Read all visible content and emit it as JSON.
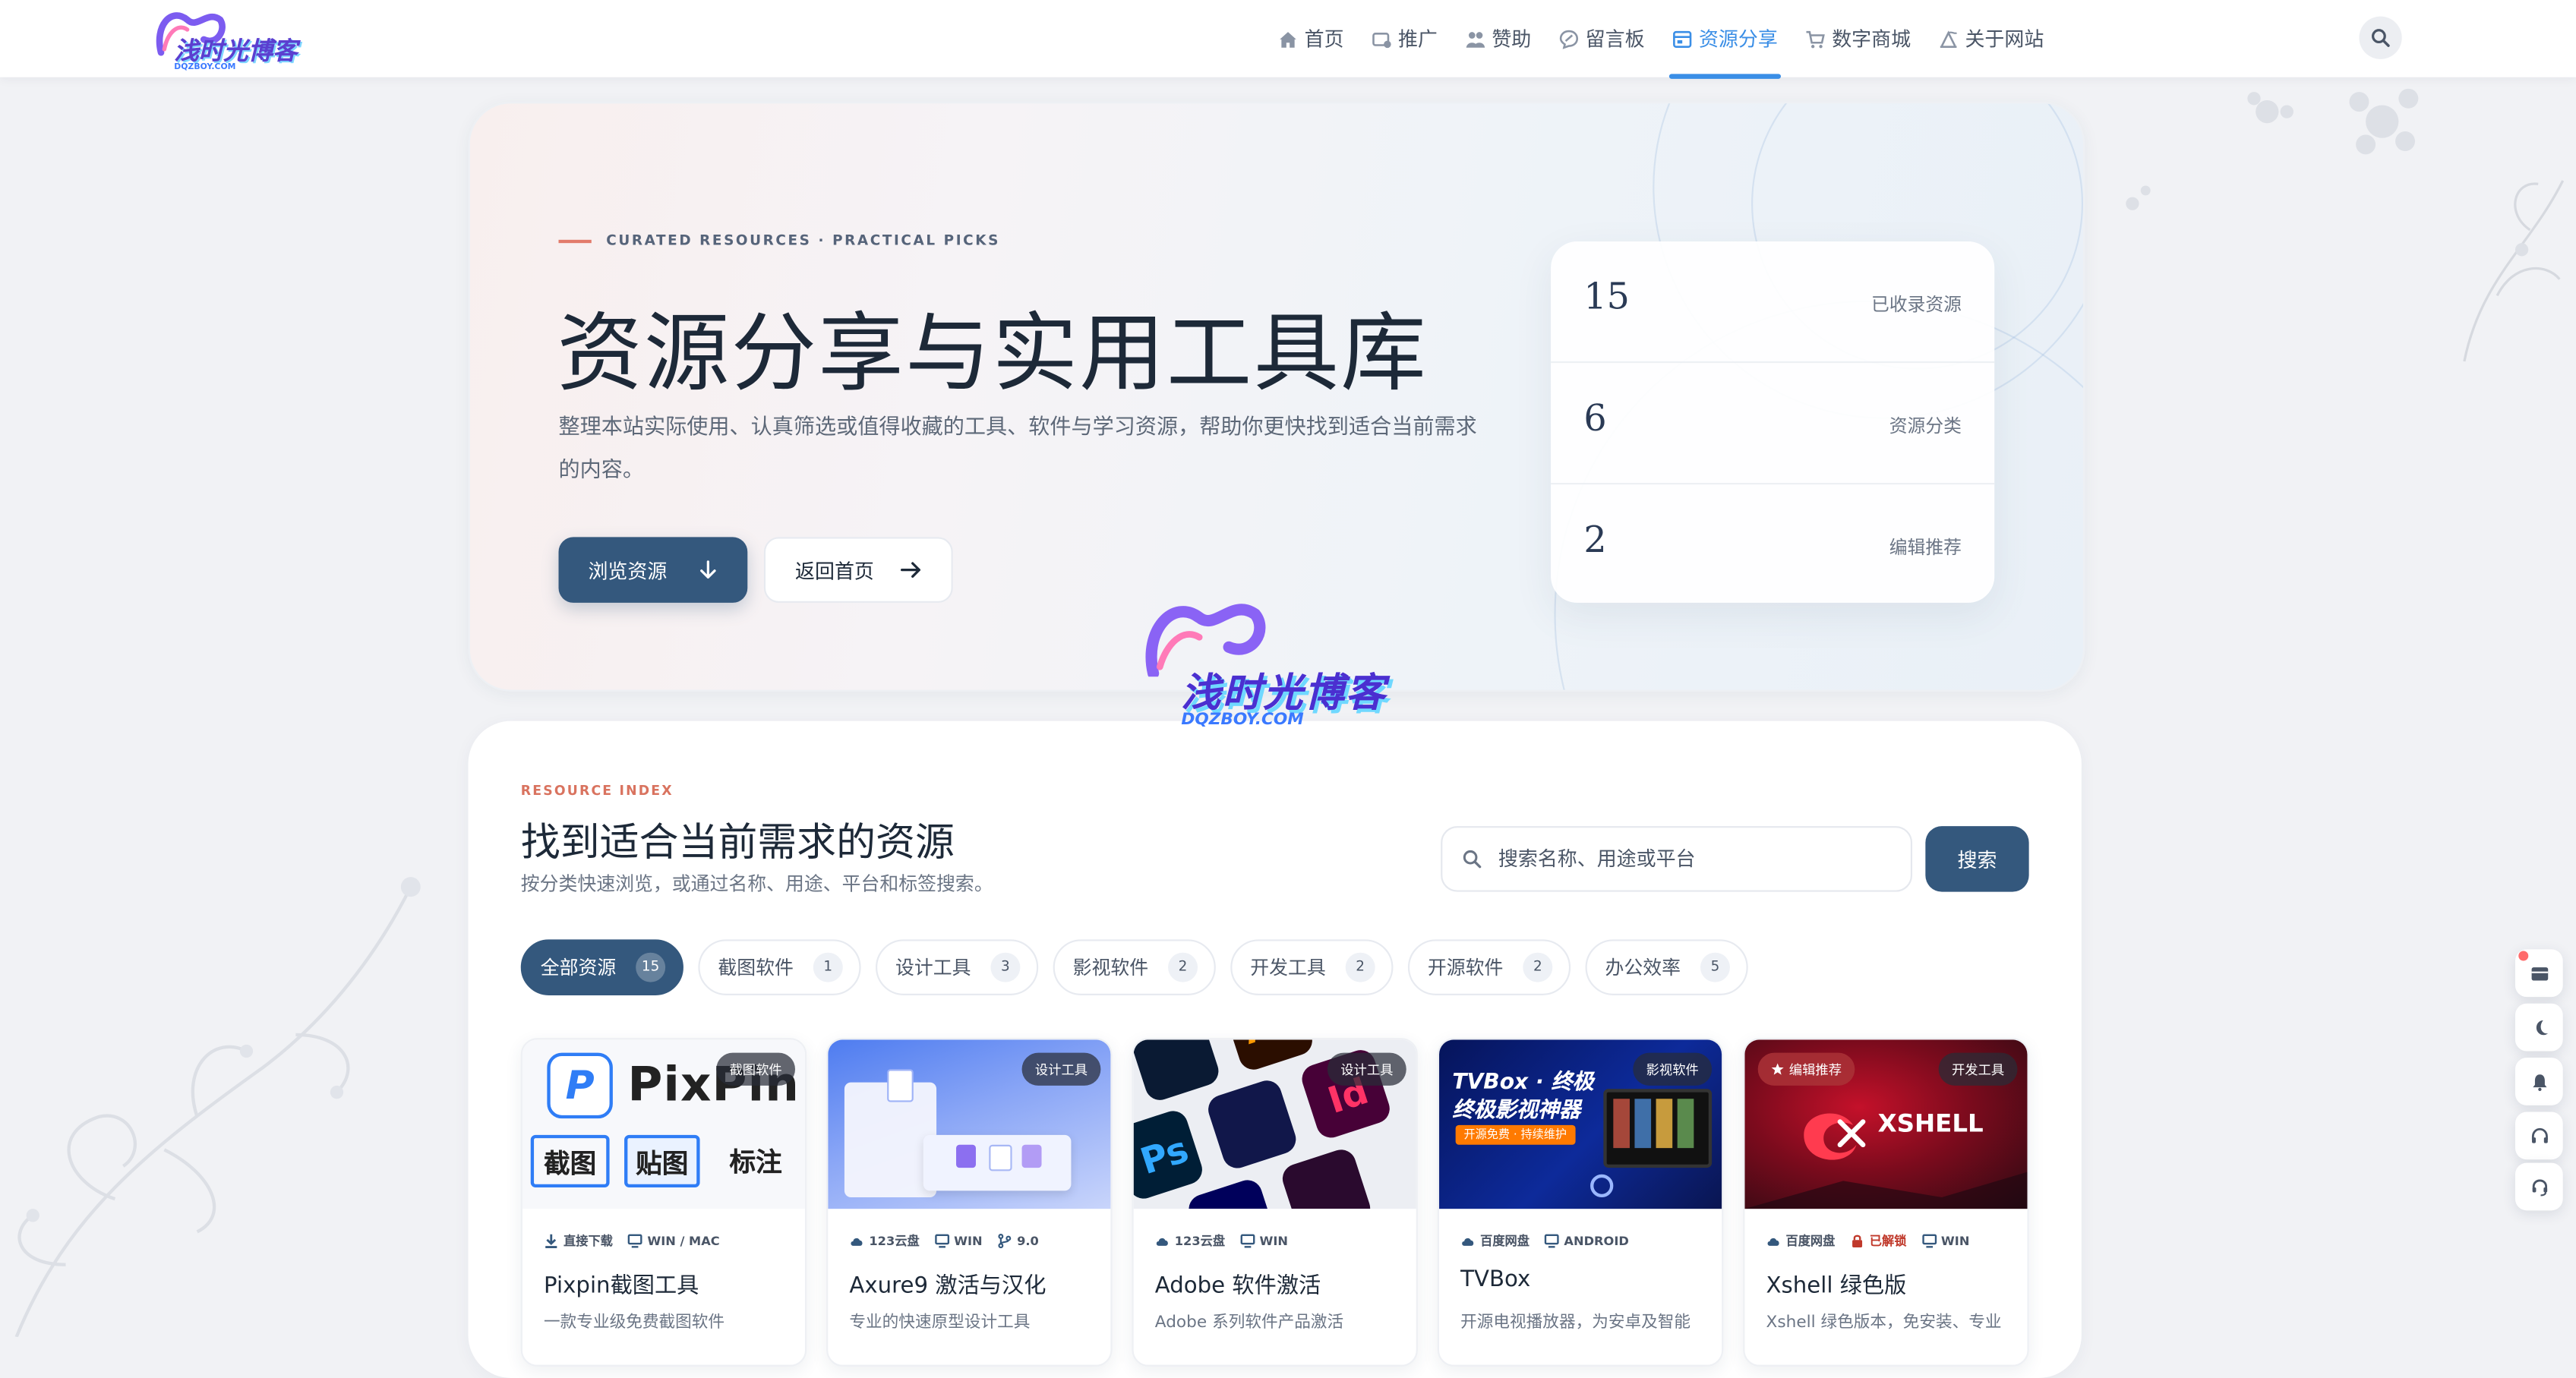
{
  "site": {
    "logo_text": "浅时光博客",
    "logo_sub": "DQZBOY.COM"
  },
  "nav": {
    "items": [
      {
        "label": "首页",
        "icon": "home-icon"
      },
      {
        "label": "推广",
        "icon": "ad-icon"
      },
      {
        "label": "赞助",
        "icon": "sponsor-icon"
      },
      {
        "label": "留言板",
        "icon": "message-icon"
      },
      {
        "label": "资源分享",
        "icon": "share-icon",
        "active": true
      },
      {
        "label": "数字商城",
        "icon": "cart-icon"
      },
      {
        "label": "关于网站",
        "icon": "about-icon"
      }
    ]
  },
  "hero": {
    "eyebrow": "CURATED RESOURCES · PRACTICAL PICKS",
    "title": "资源分享与实用工具库",
    "description": "整理本站实际使用、认真筛选或值得收藏的工具、软件与学习资源，帮助你更快找到适合当前需求的内容。",
    "primary_button": "浏览资源",
    "secondary_button": "返回首页",
    "stats": [
      {
        "value": "15",
        "label": "已收录资源"
      },
      {
        "value": "6",
        "label": "资源分类"
      },
      {
        "value": "2",
        "label": "编辑推荐"
      }
    ]
  },
  "watermark": {
    "text": "浅时光博客",
    "sub": "DQZBOY.COM"
  },
  "resources": {
    "eyebrow": "RESOURCE INDEX",
    "title": "找到适合当前需求的资源",
    "subtitle": "按分类快速浏览，或通过名称、用途、平台和标签搜索。",
    "search_placeholder": "搜索名称、用途或平台",
    "search_button": "搜索",
    "filters": [
      {
        "label": "全部资源",
        "count": "15",
        "active": true
      },
      {
        "label": "截图软件",
        "count": "1"
      },
      {
        "label": "设计工具",
        "count": "3"
      },
      {
        "label": "影视软件",
        "count": "2"
      },
      {
        "label": "开发工具",
        "count": "2"
      },
      {
        "label": "开源软件",
        "count": "2"
      },
      {
        "label": "办公效率",
        "count": "5"
      }
    ],
    "cards": [
      {
        "tag": "截图软件",
        "thumb_text": "PixPin",
        "thumb_sub": [
          "截图",
          "贴图",
          "标注"
        ],
        "source": "直接下载",
        "platform": "WIN / MAC",
        "title": "Pixpin截图工具",
        "desc": "一款专业级免费截图软件"
      },
      {
        "tag": "设计工具",
        "source": "123云盘",
        "platform": "WIN",
        "version": "9.0",
        "title": "Axure9 激活与汉化",
        "desc": "专业的快速原型设计工具"
      },
      {
        "tag": "设计工具",
        "source": "123云盘",
        "platform": "WIN",
        "title": "Adobe 软件激活",
        "desc": "Adobe 系列软件产品激活"
      },
      {
        "tag": "影视软件",
        "thumb_text": "TVBox · 终极",
        "thumb_text2": "终极影视神器",
        "thumb_sub": "开源免费 · 持续维护",
        "source": "百度网盘",
        "platform": "ANDROID",
        "title": "TVBox",
        "desc": "开源电视播放器，为安卓及智能"
      },
      {
        "tag": "开发工具",
        "badge": "编辑推荐",
        "thumb_text": "XSHELL",
        "source": "百度网盘",
        "locked": "已解锁",
        "platform": "WIN",
        "title": "Xshell 绿色版",
        "desc": "Xshell 绿色版本，免安装、专业"
      }
    ]
  }
}
